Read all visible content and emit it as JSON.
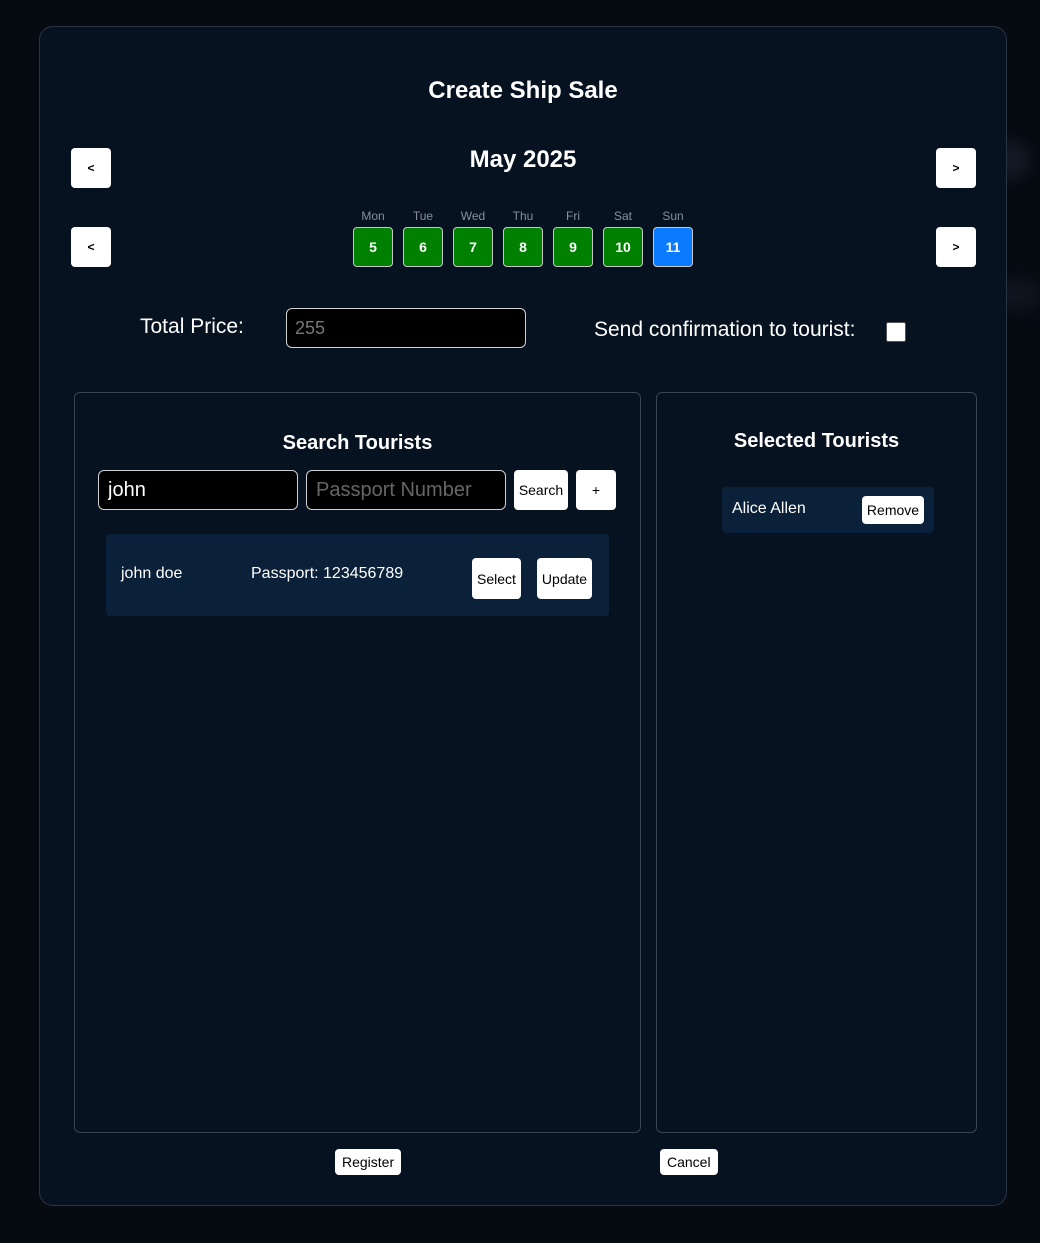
{
  "modal": {
    "title": "Create Ship Sale"
  },
  "calendar": {
    "month_label": "May 2025",
    "prev_month_label": "<",
    "next_month_label": ">",
    "prev_week_label": "<",
    "next_week_label": ">",
    "days": [
      {
        "name": "Mon",
        "number": "5",
        "state": "available"
      },
      {
        "name": "Tue",
        "number": "6",
        "state": "available"
      },
      {
        "name": "Wed",
        "number": "7",
        "state": "available"
      },
      {
        "name": "Thu",
        "number": "8",
        "state": "available"
      },
      {
        "name": "Fri",
        "number": "9",
        "state": "available"
      },
      {
        "name": "Sat",
        "number": "10",
        "state": "available"
      },
      {
        "name": "Sun",
        "number": "11",
        "state": "selected"
      }
    ],
    "colors": {
      "available": "#008000",
      "selected": "#0a7bff"
    }
  },
  "pricing": {
    "total_price_label": "Total Price:",
    "total_price_placeholder": "255",
    "total_price_value": "",
    "send_confirmation_label": "Send confirmation to tourist:",
    "send_confirmation_checked": false
  },
  "search": {
    "title": "Search Tourists",
    "name_value": "john",
    "passport_placeholder": "Passport Number",
    "search_button": "Search",
    "add_button": "+",
    "results": [
      {
        "name": "john doe",
        "passport": "Passport: 123456789",
        "select_label": "Select",
        "update_label": "Update"
      }
    ]
  },
  "selected": {
    "title": "Selected Tourists",
    "items": [
      {
        "name": "Alice Allen",
        "remove_label": "Remove"
      }
    ]
  },
  "footer": {
    "register_label": "Register",
    "cancel_label": "Cancel"
  }
}
